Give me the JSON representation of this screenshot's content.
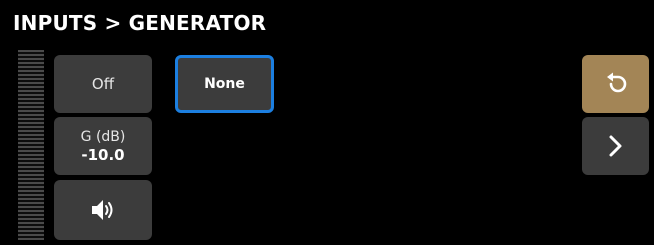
{
  "header": {
    "title": "INPUTS > GENERATOR"
  },
  "controls": {
    "mute_label": "Off",
    "gain_label": "G (dB)",
    "gain_value": "-10.0",
    "source_label": "None",
    "speaker_icon": "speaker-icon"
  },
  "nav": {
    "undo_icon": "undo-icon",
    "next_icon": "chevron-right-icon"
  },
  "colors": {
    "background": "#000000",
    "button": "#3c3c3c",
    "selected_border": "#1c7fe0",
    "undo_button": "#a38556"
  }
}
